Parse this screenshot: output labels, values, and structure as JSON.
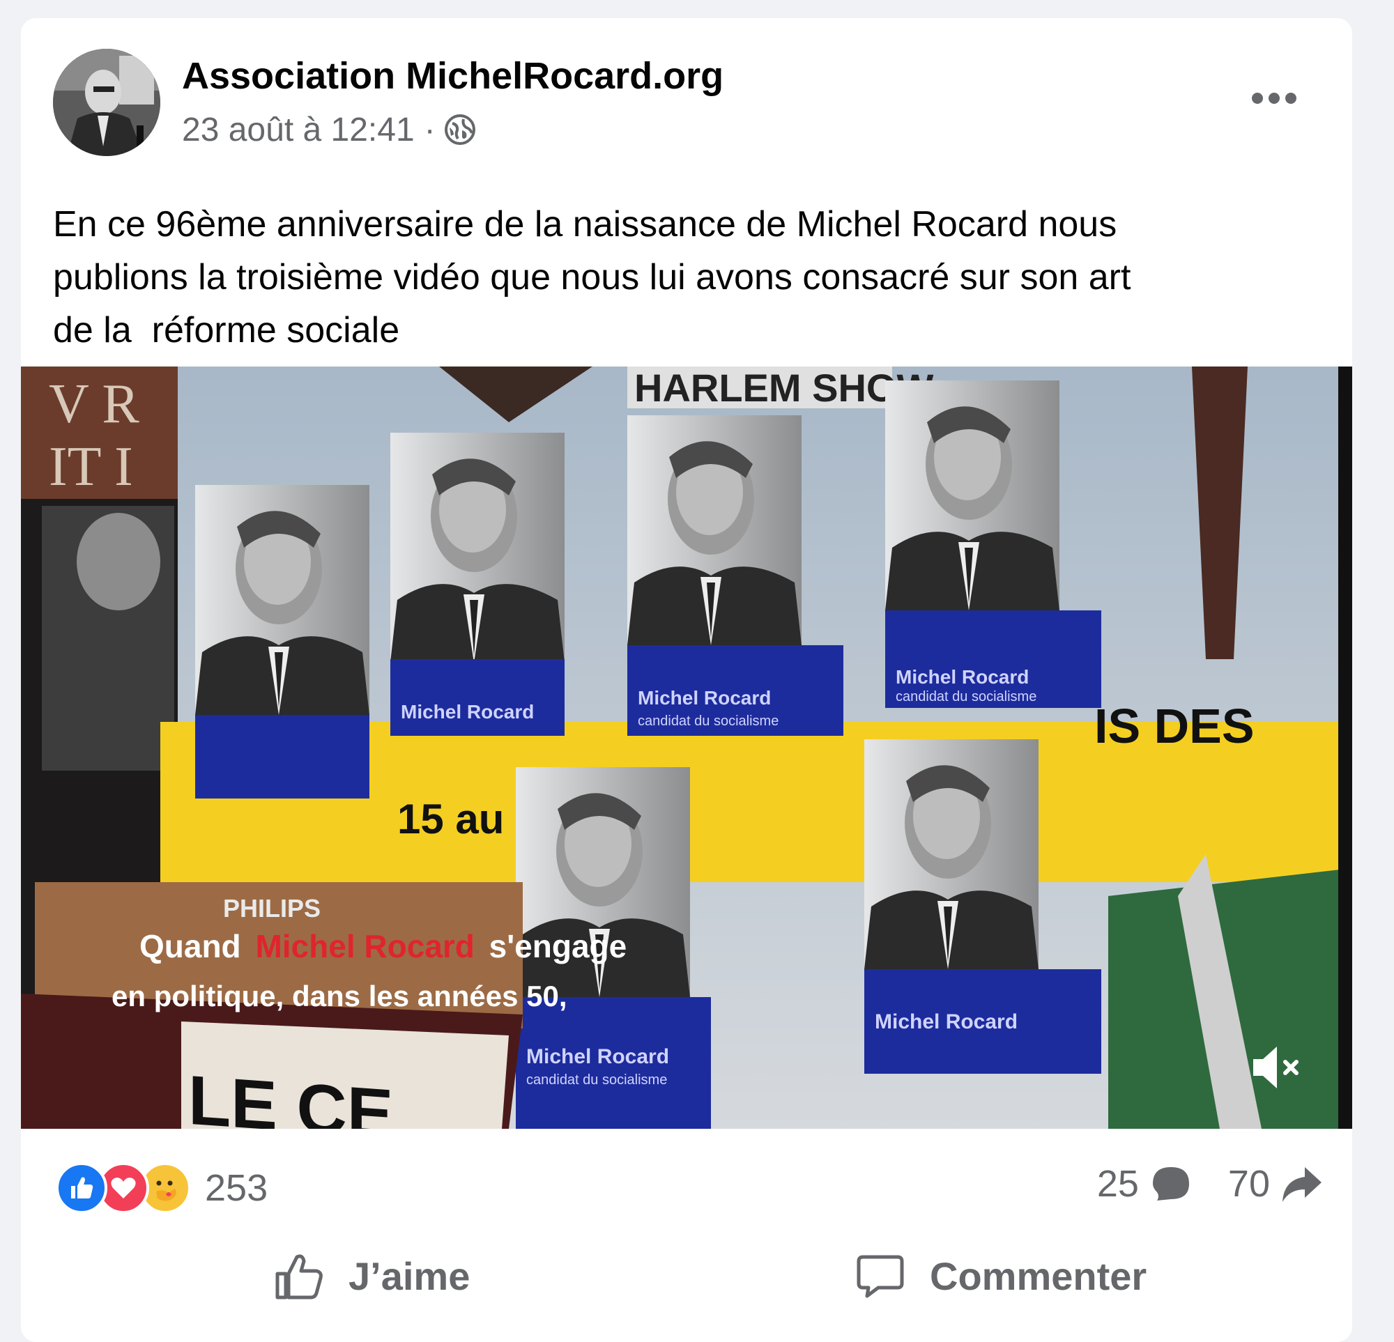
{
  "post": {
    "author": "Association MichelRocard.org",
    "date": "23 août à 12:41",
    "separator": "·",
    "privacy_icon": "globe-icon",
    "text": "En ce 96ème anniversaire de la naissance de Michel Rocard nous\npublions la troisième vidéo que nous lui avons consacré sur son art\nde la  réforme sociale",
    "more_icon": "more-options-icon"
  },
  "video": {
    "poster_top_text": "HARLEM SHOW",
    "poster_left_text": "V R\nIT I",
    "poster_name_1": "Michel Rocard",
    "poster_sub_1": "candidat du socialisme",
    "poster_yellow_1": "IS  DES",
    "poster_yellow_2": "15 au",
    "brand_text": "PHILIPS",
    "caption_line_1_a": "Quand",
    "caption_line_1_b": "Michel Rocard",
    "caption_line_1_c": "s'engage",
    "caption_line_2": "en politique, dans les années 50,",
    "bottom_text": "LE CE",
    "mute_icon": "volume-muted-icon"
  },
  "stats": {
    "reaction_icons": [
      "like-reaction-icon",
      "love-reaction-icon",
      "care-reaction-icon"
    ],
    "reactions_count": "253",
    "comments_count": "25",
    "shares_count": "70"
  },
  "actions": {
    "like_label": "J’aime",
    "comment_label": "Commenter"
  },
  "colors": {
    "like_blue": "#1877f2",
    "love_red": "#f33e58",
    "text_secondary": "#65676b",
    "poster_blue": "#1d2c9c",
    "poster_yellow": "#f4cf22"
  }
}
